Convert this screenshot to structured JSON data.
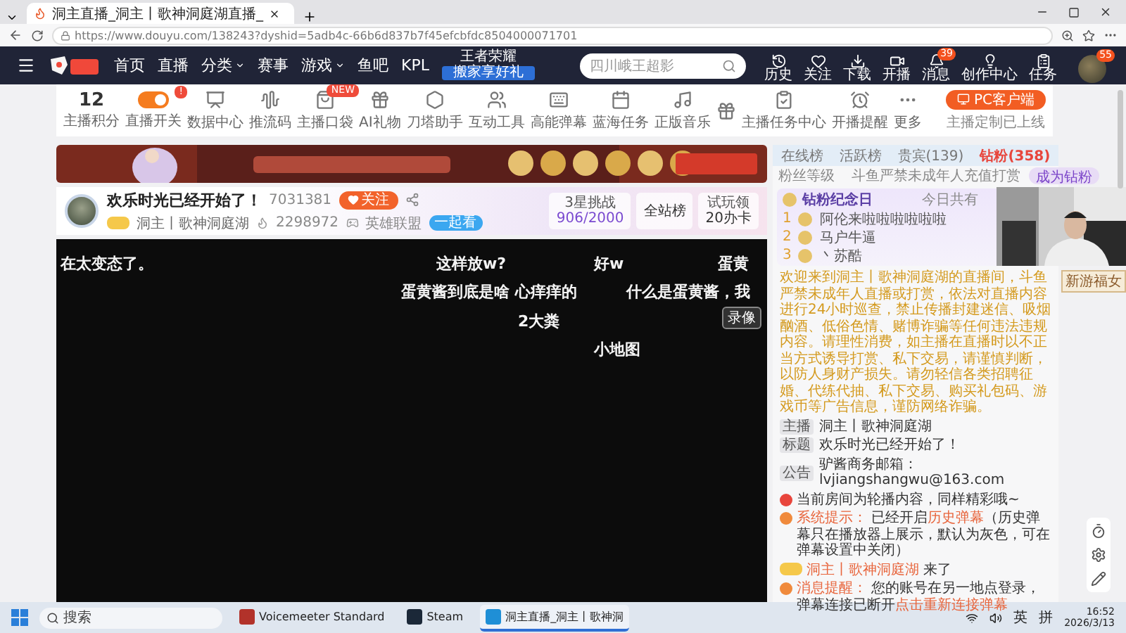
{
  "browser": {
    "tab_title": "洞主直播_洞主丨歌神洞庭湖直播_",
    "url": "https://www.douyu.com/138243?dyshid=5adb4c-66b6d837b7f45efcbfdc8504000071701"
  },
  "nav": {
    "links": [
      {
        "label": "首页",
        "dropdown": false
      },
      {
        "label": "直播",
        "dropdown": false
      },
      {
        "label": "分类",
        "dropdown": true
      },
      {
        "label": "赛事",
        "dropdown": false
      },
      {
        "label": "游戏",
        "dropdown": true
      },
      {
        "label": "鱼吧",
        "dropdown": false
      },
      {
        "label": "KPL",
        "dropdown": false
      }
    ],
    "promo": {
      "title": "王者荣耀",
      "badge": "搬家享好礼"
    },
    "search": {
      "placeholder": "四川峨王超影"
    },
    "actions": [
      {
        "label": "历史"
      },
      {
        "label": "关注"
      },
      {
        "label": "下载"
      },
      {
        "label": "开播"
      },
      {
        "label": "消息",
        "badge": "39"
      },
      {
        "label": "创作中心"
      },
      {
        "label": "任务"
      }
    ],
    "avatar_badge": "55"
  },
  "toolbar": {
    "points": {
      "value": "12",
      "label": "主播积分"
    },
    "live_switch": {
      "label": "直播开关",
      "on": true,
      "badge": "!"
    },
    "items": [
      {
        "kind": "tool",
        "label": "数据中心"
      },
      {
        "kind": "tool",
        "label": "推流码"
      },
      {
        "kind": "tool",
        "label": "主播口袋",
        "badge": "NEW"
      },
      {
        "kind": "tool",
        "label": "AI礼物"
      },
      {
        "kind": "tool",
        "label": "刀塔助手"
      },
      {
        "kind": "tool",
        "label": "互动工具"
      },
      {
        "kind": "tool",
        "label": "高能弹幕"
      },
      {
        "kind": "tool",
        "label": "蓝海任务"
      },
      {
        "kind": "tool",
        "label": "正版音乐"
      },
      {
        "kind": "icon_only"
      },
      {
        "kind": "tool",
        "label": "主播任务中心"
      },
      {
        "kind": "tool",
        "label": "开播提醒"
      },
      {
        "kind": "tool",
        "label": "更多"
      }
    ],
    "client_button": "PC客户端",
    "client_note": "主播定制已上线"
  },
  "room": {
    "title": "欢乐时光已经开始了！",
    "followers": "7031381",
    "follow_button": "关注",
    "streamer": "洞主丨歌神洞庭湖",
    "heat": "2298972",
    "category": "英雄联盟",
    "tag": "一起看",
    "challenge": {
      "title": "3星挑战",
      "progress": "906/2000"
    },
    "rank_button": "全站榜",
    "trial": {
      "title": "试玩领",
      "reward": "20办卡"
    }
  },
  "video": {
    "danmaku": [
      "在太变态了。",
      "这样放w?",
      "好w",
      "蛋黄",
      "蛋黄酱到底是啥 心痒痒的",
      "什么是蛋黄酱，我",
      "2大粪",
      "小地图"
    ],
    "record_button": "录像"
  },
  "chat": {
    "rank_tabs": [
      {
        "label": "在线榜",
        "selected": false
      },
      {
        "label": "活跃榜",
        "selected": false
      },
      {
        "label": "贵宾(139)",
        "selected": false
      },
      {
        "label": "钻粉(358)",
        "selected": true
      }
    ],
    "fan_level": "粉丝等级",
    "notice": "斗鱼严禁未成年人充值打赏",
    "join_button": "成为钻粉",
    "anniversary": {
      "title": "钻粉纪念日",
      "count_text": "今日共有",
      "rows": [
        {
          "rank": "1",
          "name": "阿伦来啦啦啦啦啦啦"
        },
        {
          "rank": "2",
          "name": "马户牛逼"
        },
        {
          "rank": "3",
          "name": "丶苏酷"
        }
      ]
    },
    "messages": [
      {
        "kind": "notice",
        "text": "欢迎来到洞主丨歌神洞庭湖的直播间，斗鱼严禁未成年人直播或打赏，依法对直播内容进行24小时巡查，禁止传播封建迷信、吸烟酗酒、低俗色情、赌博诈骗等任何违法违规内容。请理性消费，如主播在直播时以不正当方式诱导打赏、私下交易，请谨慎判断，以防人身财产损失。请勿轻信各类招聘征婚、代练代抽、私下交易、购买礼包码、游戏币等广告信息，谨防网络诈骗。"
      },
      {
        "kind": "info",
        "tag": "主播",
        "text": "洞主丨歌神洞庭湖"
      },
      {
        "kind": "info",
        "tag": "标题",
        "text": "欢乐时光已经开始了！"
      },
      {
        "kind": "info",
        "tag": "公告",
        "text": "驴酱商务邮箱：lvjiangshangwu@163.com"
      },
      {
        "kind": "system",
        "text": "当前房间为轮播内容，同样精彩哦~"
      },
      {
        "kind": "alert",
        "label": "系统提示：",
        "text": "已经开启",
        "link": "历史弹幕",
        "tail": "（历史弹幕只在播放器上展示，默认为灰色，可在弹幕设置中关闭）"
      },
      {
        "kind": "enter",
        "user": "洞主丨歌神洞庭湖",
        "text": "来了"
      },
      {
        "kind": "alert",
        "label": "消息提醒：",
        "text": "您的账号在另一地点登录，弹幕连接已断开",
        "link": "点击重新连接弹幕"
      }
    ]
  },
  "side_banner": "新游福女",
  "taskbar": {
    "search": "搜索",
    "apps": [
      {
        "label": "Voicemeeter Standard",
        "selected": false
      },
      {
        "label": "Steam",
        "selected": false
      },
      {
        "label": "洞主直播_洞主丨歌神洞",
        "selected": true
      }
    ],
    "ime": [
      "英",
      "拼"
    ],
    "time": "16:52",
    "date": "2026/3/13"
  }
}
